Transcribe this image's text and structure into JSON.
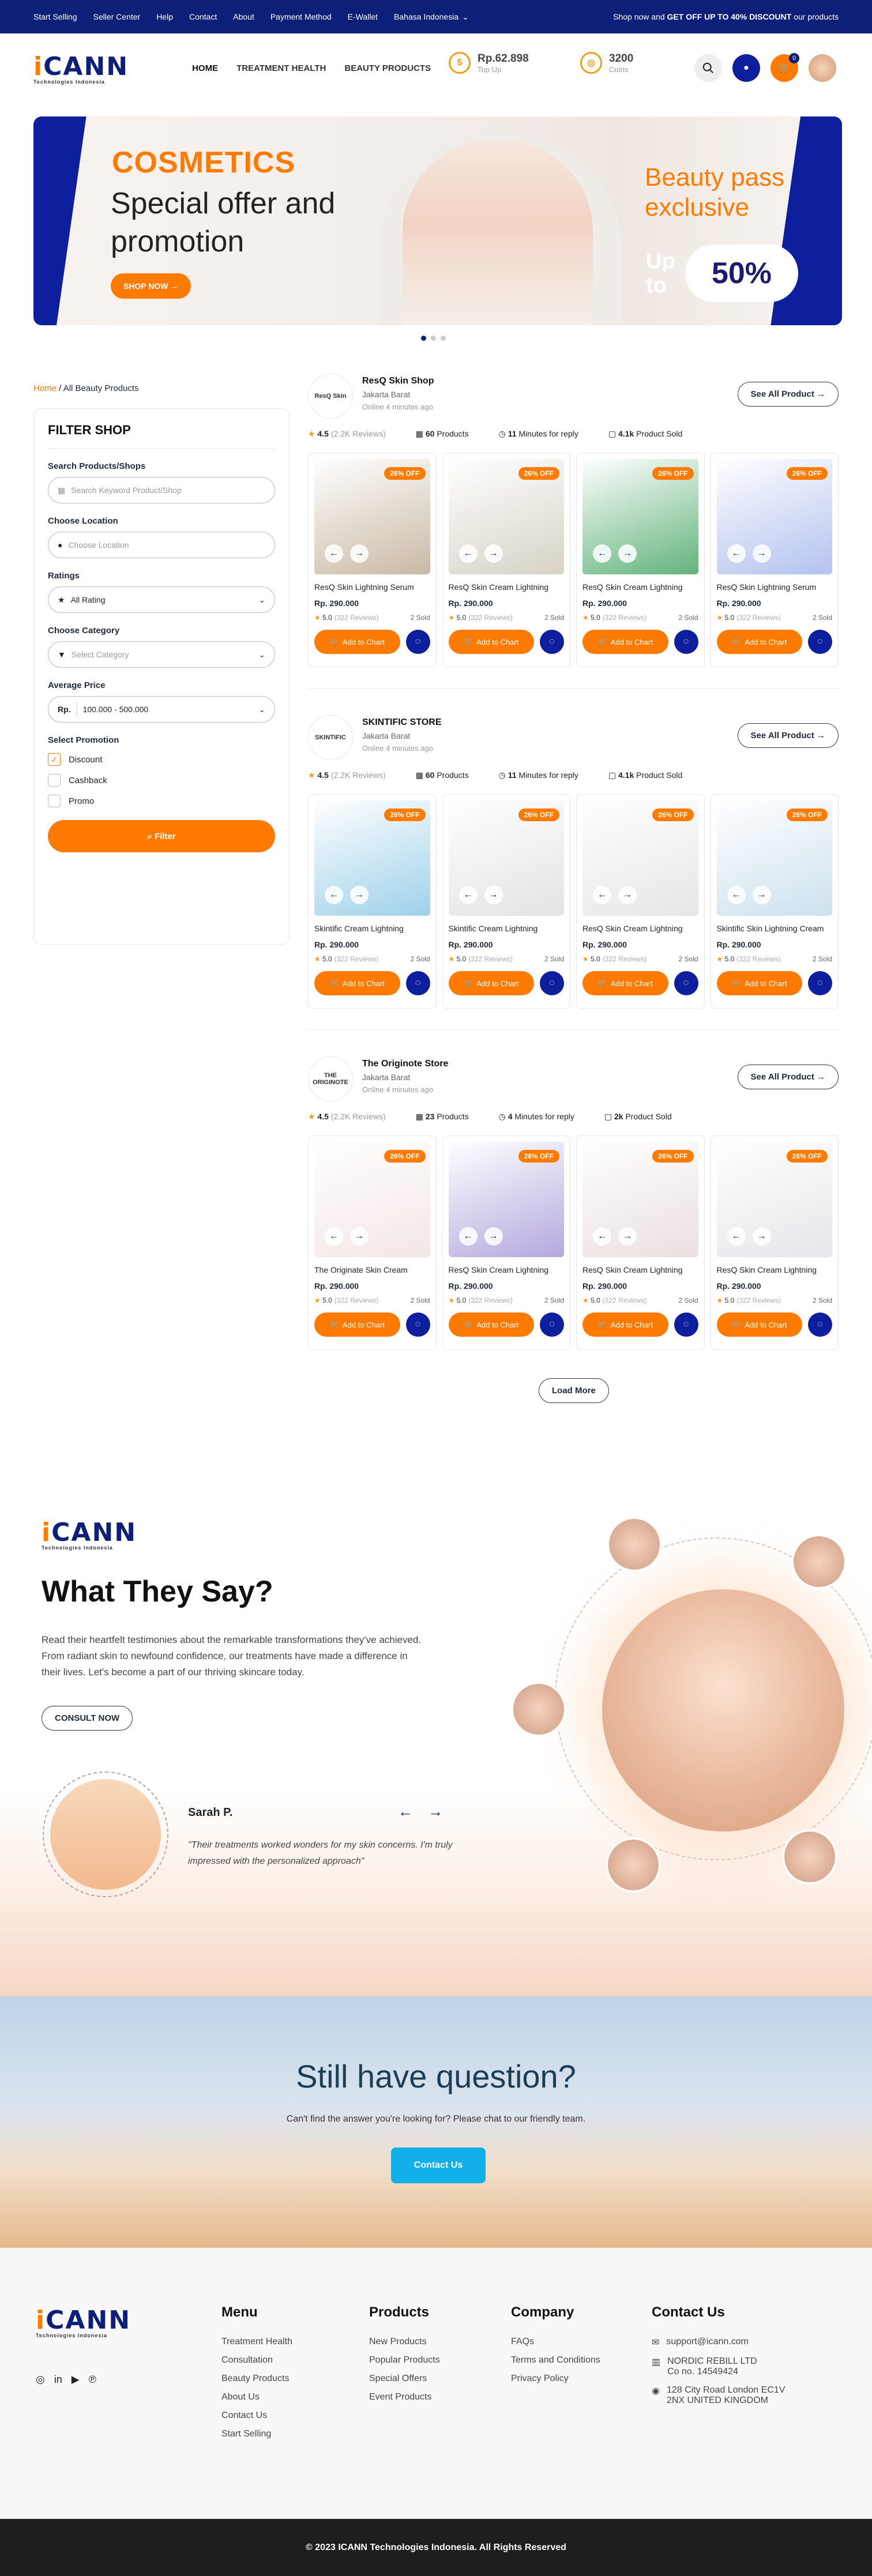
{
  "topbar": {
    "links": [
      "Start Selling",
      "Seller Center",
      "Help",
      "Contact",
      "About",
      "Payment Method",
      "E-Wallet",
      "Bahasa Indonesia"
    ],
    "promo_pre": "Shop now and ",
    "promo_bold": "GET OFF UP TO 40% DISCOUNT",
    "promo_post": " our products"
  },
  "header": {
    "logo": "iCANN",
    "logo_sub": "Technologies Indonesia",
    "nav": [
      "HOME",
      "TREATMENT HEALTH",
      "BEAUTY PRODUCTS"
    ],
    "balance": "Rp.62.898",
    "balance_label": "Top Up",
    "coins": "3200",
    "coins_label": "Coins",
    "cart_count": "0"
  },
  "banner": {
    "title": "COSMETICS",
    "subtitle": "Special offer and promotion",
    "cta": "SHOP NOW →",
    "badge": "Beauty pass exclusive",
    "upto": "Up to",
    "percent": "50%"
  },
  "breadcrumb": {
    "home": "Home",
    "current": "All Beauty Products"
  },
  "filter": {
    "title": "FILTER SHOP",
    "search_label": "Search Products/Shops",
    "search_placeholder": "Search Keyword Product/Shop",
    "location_label": "Choose Location",
    "location_placeholder": "Choose Location",
    "ratings_label": "Ratings",
    "ratings_value": "All Rating",
    "category_label": "Choose Category",
    "category_placeholder": "Select Category",
    "price_label": "Average Price",
    "price_prefix": "Rp.",
    "price_value": "100.000 - 500.000",
    "promo_label": "Select Promotion",
    "promos": [
      {
        "label": "Discount",
        "checked": true
      },
      {
        "label": "Cashback",
        "checked": false
      },
      {
        "label": "Promo",
        "checked": false
      }
    ],
    "button": "Filter"
  },
  "stores": [
    {
      "logo": "ResQ Skin",
      "name": "ResQ Skin Shop",
      "location": "Jakarta Barat",
      "online": "Online 4 minutes ago",
      "see_all": "See All Product →",
      "rating": "4.5",
      "reviews": "(2.2K Reviews)",
      "products": "60",
      "products_label": "Products",
      "reply": "11",
      "reply_label": "Minutes for reply",
      "sold": "4.1k",
      "sold_label": "Product Sold",
      "items": [
        {
          "name": "ResQ Skin Lightning Serum",
          "price": "Rp. 290.000",
          "rating": "5.0",
          "reviews": "(322 Reviews)",
          "sold": "2 Sold",
          "off": "26% OFF",
          "color": "#c9b9a4"
        },
        {
          "name": "ResQ Skin Cream Lightning",
          "price": "Rp. 290.000",
          "rating": "5.0",
          "reviews": "(322 Reviews)",
          "sold": "2 Sold",
          "off": "26% OFF",
          "color": "#d8d2c6"
        },
        {
          "name": "ResQ Skin Cream Lightning",
          "price": "Rp. 290.000",
          "rating": "5.0",
          "reviews": "(322 Reviews)",
          "sold": "2 Sold",
          "off": "26% OFF",
          "color": "#62b37c"
        },
        {
          "name": "ResQ Skin Lightning Serum",
          "price": "Rp. 290.000",
          "rating": "5.0",
          "reviews": "(322 Reviews)",
          "sold": "2 Sold",
          "off": "26% OFF",
          "color": "#b3c2ef"
        }
      ]
    },
    {
      "logo": "SKINTIFIC",
      "name": "SKINTIFIC STORE",
      "location": "Jakarta Barat",
      "online": "Online 4 minutes ago",
      "see_all": "See All Product →",
      "rating": "4.5",
      "reviews": "(2.2K Reviews)",
      "products": "60",
      "products_label": "Products",
      "reply": "11",
      "reply_label": "Minutes for reply",
      "sold": "4.1k",
      "sold_label": "Product Sold",
      "items": [
        {
          "name": "Skintific Cream Lightning",
          "price": "Rp. 290.000",
          "rating": "5.0",
          "reviews": "(322 Reviews)",
          "sold": "2 Sold",
          "off": "26% OFF",
          "color": "#9ed1ea"
        },
        {
          "name": "Skintific Cream Lightning",
          "price": "Rp. 290.000",
          "rating": "5.0",
          "reviews": "(322 Reviews)",
          "sold": "2 Sold",
          "off": "26% OFF",
          "color": "#e3e3e6"
        },
        {
          "name": "ResQ Skin Cream Lightning",
          "price": "Rp. 290.000",
          "rating": "5.0",
          "reviews": "(322 Reviews)",
          "sold": "2 Sold",
          "off": "26% OFF",
          "color": "#e8e5e8"
        },
        {
          "name": "Skintific Skin Lightning Cream",
          "price": "Rp. 290.000",
          "rating": "5.0",
          "reviews": "(322 Reviews)",
          "sold": "2 Sold",
          "off": "26% OFF",
          "color": "#cde1ee"
        }
      ]
    },
    {
      "logo": "THE ORIGINOTE",
      "name": "The Originote Store",
      "location": "Jakarta Barat",
      "online": "Online 4 minutes ago",
      "see_all": "See All Product →",
      "rating": "4.5",
      "reviews": "(2.2K Reviews)",
      "products": "23",
      "products_label": "Products",
      "reply": "4",
      "reply_label": "Minutes for reply",
      "sold": "2k",
      "sold_label": "Product Sold",
      "items": [
        {
          "name": "The Originate Skin  Cream",
          "price": "Rp. 290.000",
          "rating": "5.0",
          "reviews": "(322 Reviews)",
          "sold": "2 Sold",
          "off": "26% OFF",
          "color": "#f4e6e6"
        },
        {
          "name": "ResQ Skin Cream Lightning",
          "price": "Rp. 290.000",
          "rating": "5.0",
          "reviews": "(322 Reviews)",
          "sold": "2 Sold",
          "off": "26% OFF",
          "color": "#b4a8de"
        },
        {
          "name": "ResQ Skin Cream Lightning",
          "price": "Rp. 290.000",
          "rating": "5.0",
          "reviews": "(322 Reviews)",
          "sold": "2 Sold",
          "off": "26% OFF",
          "color": "#eadfe0"
        },
        {
          "name": "ResQ Skin Cream Lightning",
          "price": "Rp. 290.000",
          "rating": "5.0",
          "reviews": "(322 Reviews)",
          "sold": "2 Sold",
          "off": "26% OFF",
          "color": "#e6e6ea"
        }
      ]
    }
  ],
  "card_button": "Add to Chart",
  "load_more": "Load More",
  "testimonials": {
    "title": "What They Say?",
    "text": "Read their heartfelt testimonies about the remarkable transformations they've achieved. From radiant skin to newfound confidence, our treatments have made a difference in their lives. Let's become a part of our thriving skincare today.",
    "cta": "CONSULT NOW",
    "name": "Sarah P.",
    "quote": "\"Their treatments worked wonders for my skin concerns. I'm truly impressed with the personalized approach\""
  },
  "faq": {
    "title": "Still have question?",
    "text": "Can't find the answer you're looking for? Please chat to our friendly team.",
    "cta": "Contact Us"
  },
  "footer": {
    "menu": {
      "title": "Menu",
      "items": [
        "Treatment Health",
        "Consultation",
        "Beauty Products",
        "About Us",
        "Contact Us",
        "Start Selling"
      ]
    },
    "products": {
      "title": "Products",
      "items": [
        "New Products",
        "Popular Products",
        "Special Offers",
        "Event Products"
      ]
    },
    "company": {
      "title": "Company",
      "items": [
        "FAQs",
        "Terms and Conditions",
        "Privacy Policy"
      ]
    },
    "contact": {
      "title": "Contact Us",
      "email": "support@icann.com",
      "company": "NORDIC REBILL LTD",
      "company_no": "Co no. 14549424",
      "address1": "128 City Road London EC1V",
      "address2": "2NX UNITED KINGDOM"
    },
    "copyright": "© 2023  ICANN Technologies Indonesia. All Rights Reserved"
  },
  "colors": {
    "primary": "#0e1f7a",
    "accent": "#ff7a00",
    "contact": "#12b0ea"
  }
}
